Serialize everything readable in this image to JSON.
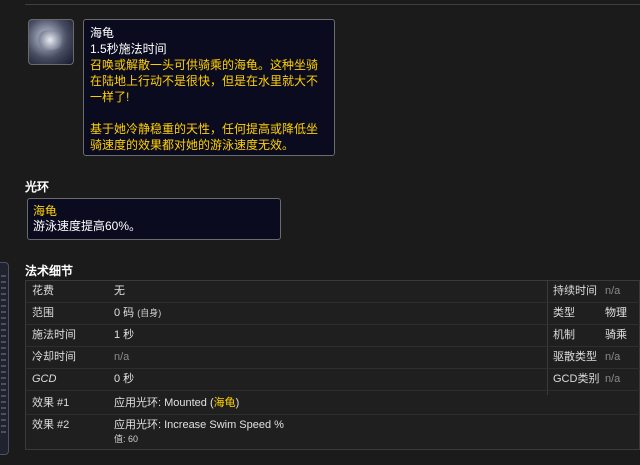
{
  "spell": {
    "name": "海龟",
    "cast_time": "1.5秒施法时间",
    "description": "召唤或解散一头可供骑乘的海龟。这种坐骑在陆地上行动不是很快，但是在水里就大不一样了!",
    "description2": "基于她冷静稳重的天性，任何提高或降低坐骑速度的效果都对她的游泳速度无效。"
  },
  "aura_section": {
    "heading": "光环",
    "name": "海龟",
    "description": "游泳速度提高60%。"
  },
  "details_section": {
    "heading": "法术细节",
    "left_rows": [
      {
        "label": "花费",
        "value": "无"
      },
      {
        "label": "范围",
        "value": "0 码",
        "extra": "(自身)"
      },
      {
        "label": "施法时间",
        "value": "1 秒"
      },
      {
        "label": "冷却时间",
        "value": "n/a"
      },
      {
        "label": "GCD",
        "value": "0 秒"
      }
    ],
    "right_rows": [
      {
        "label": "持续时间",
        "value": "n/a"
      },
      {
        "label": "类型",
        "value": "物理"
      },
      {
        "label": "机制",
        "value": "骑乘"
      },
      {
        "label": "驱散类型",
        "value": "n/a"
      },
      {
        "label": "GCD类别",
        "value": "n/a"
      }
    ],
    "effects": [
      {
        "label": "效果 #1",
        "prefix": "应用光环: Mounted (",
        "link": "海龟",
        "suffix": ")"
      },
      {
        "label": "效果 #2",
        "text": "应用光环: Increase Swim Speed %",
        "sub": "值: 60"
      }
    ]
  }
}
